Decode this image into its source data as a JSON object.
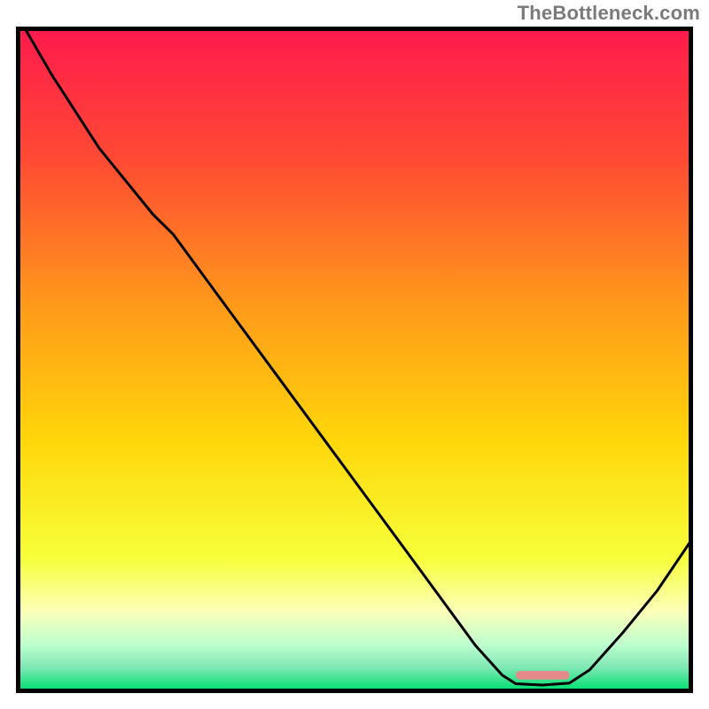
{
  "watermark": "TheBottleneck.com",
  "chart_data": {
    "type": "line",
    "title": "",
    "xlabel": "",
    "ylabel": "",
    "xlim": [
      0,
      100
    ],
    "ylim": [
      0,
      100
    ],
    "background_gradient": {
      "stops": [
        {
          "offset": 0.0,
          "color": "#ff1a4d"
        },
        {
          "offset": 0.2,
          "color": "#ff4b33"
        },
        {
          "offset": 0.42,
          "color": "#ff9a1a"
        },
        {
          "offset": 0.62,
          "color": "#ffd60a"
        },
        {
          "offset": 0.8,
          "color": "#f7ff3a"
        },
        {
          "offset": 0.88,
          "color": "#fdffb8"
        },
        {
          "offset": 0.93,
          "color": "#bfffcf"
        },
        {
          "offset": 0.965,
          "color": "#7fe8b4"
        },
        {
          "offset": 1.0,
          "color": "#00e070"
        }
      ]
    },
    "series": [
      {
        "name": "bottleneck-curve",
        "color": "#000000",
        "stroke_width": 3,
        "points": [
          {
            "x": 1.0,
            "y": 100.0
          },
          {
            "x": 5.0,
            "y": 93.0
          },
          {
            "x": 12.0,
            "y": 82.0
          },
          {
            "x": 20.0,
            "y": 72.0
          },
          {
            "x": 23.0,
            "y": 69.0
          },
          {
            "x": 30.0,
            "y": 59.3
          },
          {
            "x": 40.0,
            "y": 45.5
          },
          {
            "x": 50.0,
            "y": 31.7
          },
          {
            "x": 60.0,
            "y": 17.9
          },
          {
            "x": 68.0,
            "y": 6.8
          },
          {
            "x": 72.0,
            "y": 2.3
          },
          {
            "x": 74.0,
            "y": 1.0
          },
          {
            "x": 78.0,
            "y": 0.8
          },
          {
            "x": 82.0,
            "y": 1.1
          },
          {
            "x": 85.0,
            "y": 3.1
          },
          {
            "x": 90.0,
            "y": 8.8
          },
          {
            "x": 95.0,
            "y": 15.0
          },
          {
            "x": 100.0,
            "y": 22.5
          }
        ]
      }
    ],
    "marker": {
      "name": "optimal-range-pill",
      "color": "#e58a8a",
      "x_start": 74.0,
      "x_end": 82.0,
      "y": 2.3,
      "thickness_pct": 1.3
    },
    "frame": {
      "stroke": "#000000",
      "stroke_width": 5
    }
  }
}
